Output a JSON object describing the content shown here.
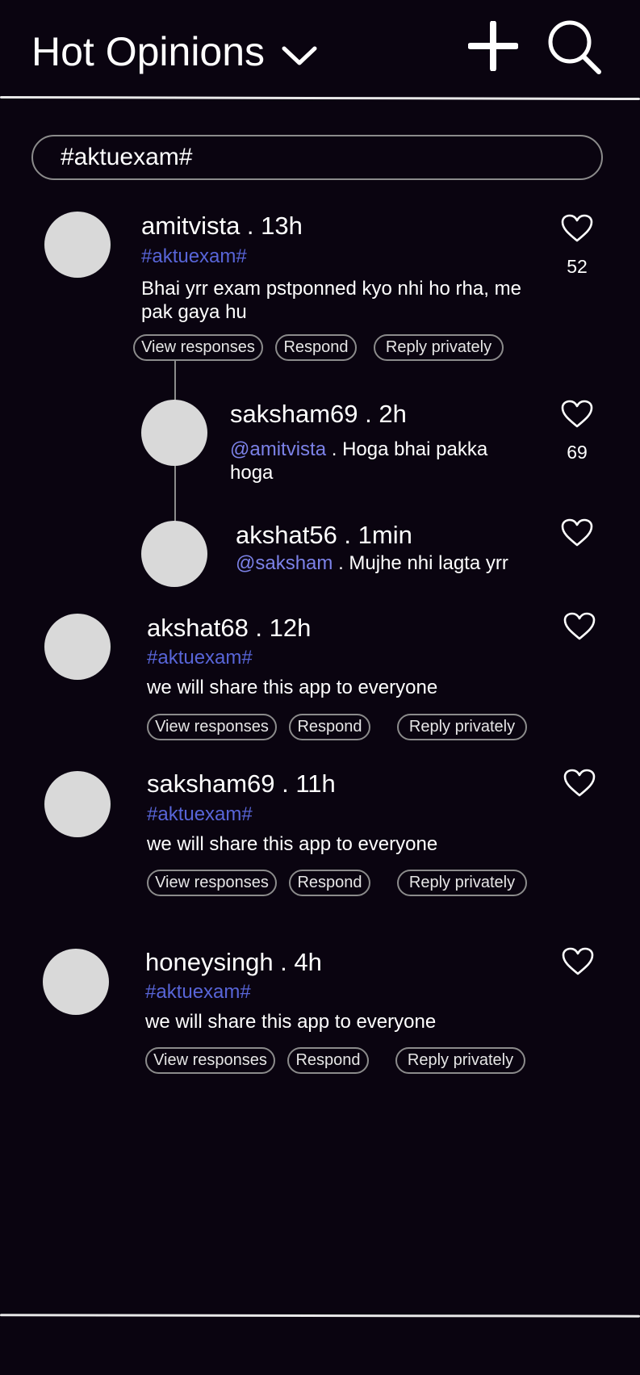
{
  "header": {
    "title": "Hot Opinions",
    "icons": [
      "chevron-down-icon",
      "plus-icon",
      "search-icon"
    ]
  },
  "search": {
    "value": "#aktuexam#"
  },
  "colors": {
    "background": "#0a0410",
    "hashtag": "#5865d8",
    "mention": "#7c82e8",
    "avatar": "#d9d9d9",
    "pill_border": "#8b8b8b"
  },
  "actions": {
    "view": "View responses",
    "respond": "Respond",
    "private": "Reply privately"
  },
  "posts": [
    {
      "user": "amitvista . 13h",
      "hashtag": "#aktuexam#",
      "text_line1": "Bhai yrr exam pstponned kyo nhi ho rha, me",
      "text_line2": "pak gaya hu",
      "likes": "52",
      "replies": [
        {
          "user": "saksham69 .  2h",
          "mention": "@amitvista",
          "text": " . Hoga bhai pakka",
          "text_line2": "hoga",
          "likes": "69"
        },
        {
          "user": "akshat56 . 1min",
          "mention": "@saksham",
          "text": " . Mujhe nhi lagta yrr"
        }
      ]
    },
    {
      "user": "akshat68 . 12h",
      "hashtag": "#aktuexam#",
      "text": "we will share this app to everyone"
    },
    {
      "user": "saksham69 . 11h",
      "hashtag": "#aktuexam#",
      "text": "we will share this app to everyone"
    },
    {
      "user": "honeysingh . 4h",
      "hashtag": "#aktuexam#",
      "text": "we will share this app to everyone"
    }
  ]
}
